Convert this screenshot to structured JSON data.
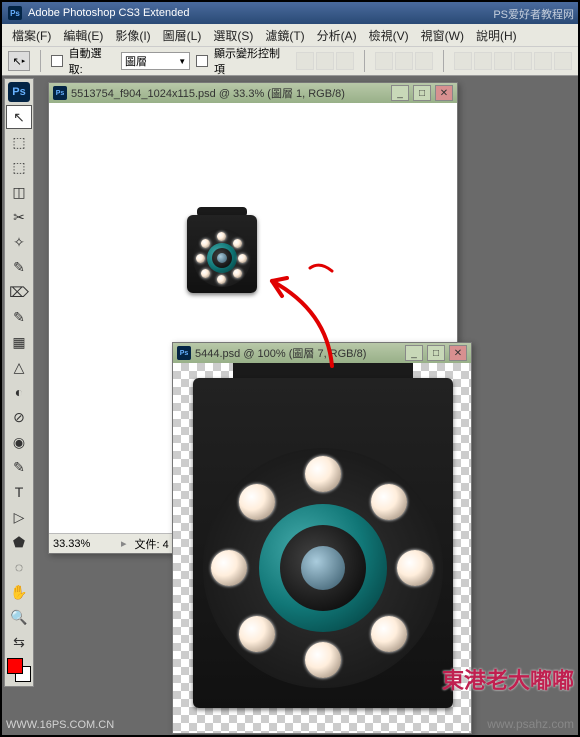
{
  "app": {
    "title": "Adobe Photoshop CS3 Extended"
  },
  "menu": {
    "items": [
      "檔案(F)",
      "編輯(E)",
      "影像(I)",
      "圖層(L)",
      "選取(S)",
      "濾鏡(T)",
      "分析(A)",
      "檢視(V)",
      "視窗(W)",
      "說明(H)"
    ]
  },
  "options": {
    "auto_select_label": "自動選取:",
    "dropdown_value": "圖層",
    "show_transform_label": "顯示變形控制項"
  },
  "tools": {
    "icons": [
      "↖",
      "⬚",
      "⬚",
      "◫",
      "✂",
      "✧",
      "✎",
      "⌦",
      "✎",
      "▦",
      "△",
      "◐",
      "⊘",
      "◉",
      "✎",
      "T",
      "▷",
      "⬟",
      "◌",
      "✋",
      "🔍",
      "⇆"
    ]
  },
  "doc1": {
    "title": "5513754_f904_1024x115.psd @ 33.3% (圖層 1, RGB/8)",
    "zoom": "33.33%",
    "status_file": "文件: 4"
  },
  "doc2": {
    "title": "5444.psd @ 100% (圖層 7, RGB/8)"
  },
  "watermarks": {
    "top_right": "PS爱好者教程网",
    "bottom_right": "www.psahz.com",
    "bottom_left": "WWW.16PS.COM.CN",
    "pink": "東港老大嘟嘟"
  },
  "colors": {
    "foreground": "#ff0000",
    "background": "#ffffff"
  }
}
